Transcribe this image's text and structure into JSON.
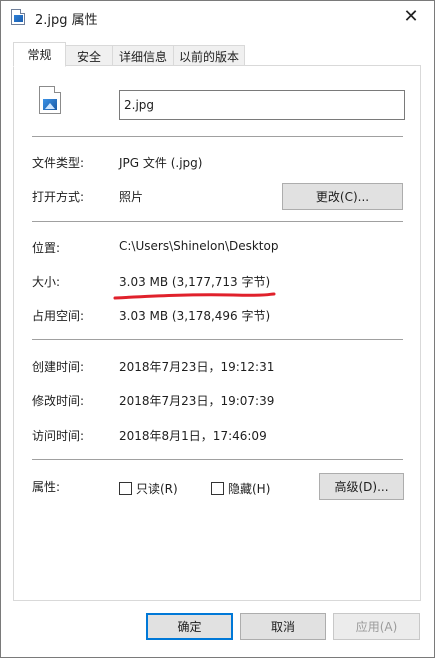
{
  "window": {
    "title": "2.jpg 属性",
    "close_glyph": "✕"
  },
  "tabs": [
    {
      "label": "常规",
      "active": true
    },
    {
      "label": "安全",
      "active": false
    },
    {
      "label": "详细信息",
      "active": false
    },
    {
      "label": "以前的版本",
      "active": false
    }
  ],
  "general": {
    "file_name": "2.jpg",
    "file_type_label": "文件类型:",
    "file_type_value": "JPG 文件 (.jpg)",
    "opens_with_label": "打开方式:",
    "opens_with_value": "照片",
    "change_button": "更改(C)...",
    "location_label": "位置:",
    "location_value": "C:\\Users\\Shinelon\\Desktop",
    "size_label": "大小:",
    "size_value": "3.03 MB (3,177,713 字节)",
    "size_on_disk_label": "占用空间:",
    "size_on_disk_value": "3.03 MB (3,178,496 字节)",
    "created_label": "创建时间:",
    "created_value": "2018年7月23日，19:12:31",
    "modified_label": "修改时间:",
    "modified_value": "2018年7月23日，19:07:39",
    "accessed_label": "访问时间:",
    "accessed_value": "2018年8月1日，17:46:09",
    "attributes_label": "属性:",
    "readonly_label": "只读(R)",
    "readonly_checked": false,
    "hidden_label": "隐藏(H)",
    "hidden_checked": false,
    "advanced_button": "高级(D)..."
  },
  "footer": {
    "ok": "确定",
    "cancel": "取消",
    "apply": "应用(A)"
  },
  "colors": {
    "annotation_red": "#e0212b",
    "focus_blue": "#0078d7"
  },
  "icons": {
    "title": "image-file-icon",
    "file": "image-file-icon",
    "close": "close-icon"
  }
}
